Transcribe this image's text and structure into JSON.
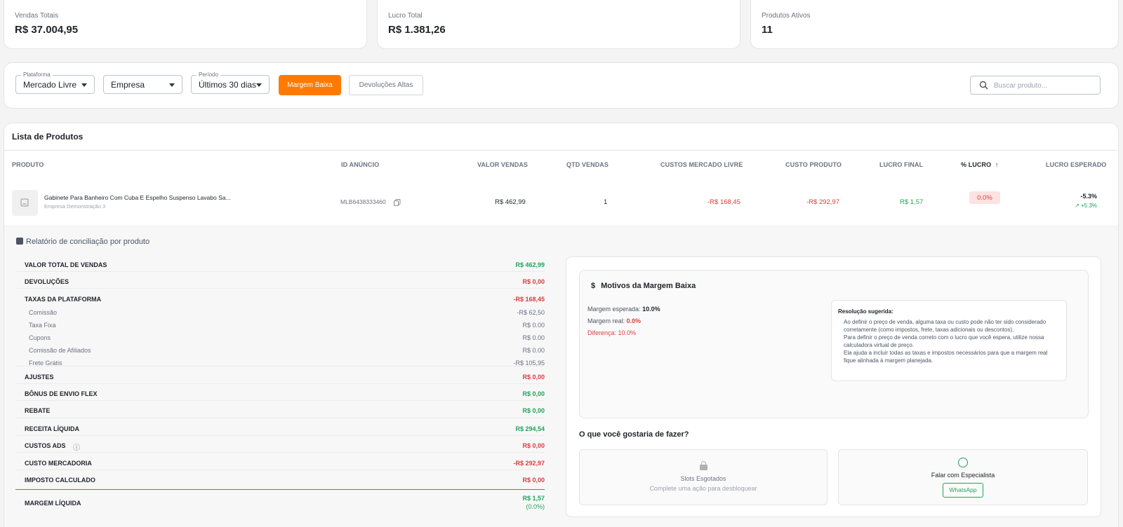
{
  "stats": [
    {
      "label": "Vendas Totais",
      "value": "R$ 37.004,95"
    },
    {
      "label": "Lucro Total",
      "value": "R$ 1.381,26"
    },
    {
      "label": "Produtos Ativos",
      "value": "11"
    }
  ],
  "filters": {
    "plataforma_legend": "Plataforma",
    "plataforma_value": "Mercado Livre",
    "empresa_value": "Empresa",
    "periodo_legend": "Período",
    "periodo_value": "Últimos 30 dias",
    "margem_baixa": "Margem Baixa",
    "devolucoes_altas": "Devoluções Altas",
    "search_placeholder": "Buscar produto..."
  },
  "list": {
    "title": "Lista de Produtos",
    "headers": [
      "PRODUTO",
      "ID ANÚNCIO",
      "VALOR VENDAS",
      "QTD VENDAS",
      "CUSTOS MERCADO LIVRE",
      "CUSTO PRODUTO",
      "LUCRO FINAL",
      "% LUCRO",
      "LUCRO ESPERADO"
    ],
    "sort_arrow": "↑",
    "row": {
      "name": "Gabinete Para Banheiro Com Cuba E Espelho Suspenso Lavabo Sa...",
      "company": "Empresa Demonstração 3",
      "id": "MLB6438333460",
      "valor": "R$ 462,99",
      "qtd": "1",
      "custos_ml": "-R$ 168,45",
      "custo_prod": "-R$ 292,97",
      "lucro_final": "R$ 1,57",
      "pct_lucro": "0.0%",
      "lucro_esperado": "-5.3%",
      "lucro_esperado_trend": "+5.3%"
    }
  },
  "report": {
    "title": "Relatório de conciliação por produto",
    "rows": [
      {
        "label": "VALOR TOTAL DE VENDAS",
        "value": "R$ 462,99",
        "type": "major",
        "color": "pos"
      },
      {
        "label": "DEVOLUÇÕES",
        "value": "R$ 0,00",
        "type": "major",
        "color": "neg"
      },
      {
        "label": "TAXAS DA PLATAFORMA",
        "value": "-R$ 168,45",
        "type": "major",
        "color": "neg"
      },
      {
        "label": "Comissão",
        "value": "-R$ 62,50",
        "type": "minor"
      },
      {
        "label": "Taxa Fixa",
        "value": "R$ 0.00",
        "type": "minor"
      },
      {
        "label": "Cupons",
        "value": "R$ 0.00",
        "type": "minor"
      },
      {
        "label": "Comissão de Afiliados",
        "value": "R$ 0.00",
        "type": "minor"
      },
      {
        "label": "Frete Grátis",
        "value": "-R$ 105,95",
        "type": "minor"
      },
      {
        "label": "AJUSTES",
        "value": "R$ 0,00",
        "type": "major",
        "color": "neg"
      },
      {
        "label": "BÔNUS DE ENVIO FLEX",
        "value": "R$ 0,00",
        "type": "major",
        "color": "pos"
      },
      {
        "label": "REBATE",
        "value": "R$ 0,00",
        "type": "major",
        "color": "pos"
      },
      {
        "label": "RECEITA LÍQUIDA",
        "value": "R$ 294,54",
        "type": "major",
        "color": "pos"
      },
      {
        "label": "CUSTOS ADS",
        "value": "R$ 0,00",
        "type": "major",
        "color": "neg"
      },
      {
        "label": "CUSTO MERCADORIA",
        "value": "-R$ 292,97",
        "type": "major",
        "color": "neg"
      },
      {
        "label": "IMPOSTO CALCULADO",
        "value": "R$ 0,00",
        "type": "major",
        "color": "neg"
      }
    ],
    "margem_label": "MARGEM LÍQUIDA",
    "margem_value": "R$ 1,57",
    "margem_pct": "(0.0%)"
  },
  "motivos": {
    "title": "Motivos da Margem Baixa",
    "esperada_label": "Margem esperada:",
    "esperada_value": "10.0%",
    "real_label": "Margem real:",
    "real_value": "0.0%",
    "diferenca": "Diferença: 10.0%",
    "res_title": "Resolução sugerida:",
    "res_p1": "Ao definir o preço de venda, alguma taxa ou custo pode não ter sido considerado corretamente (como impostos, frete, taxas adicionais ou descontos).",
    "res_p2": "Para definir o preço de venda correto com o lucro que você espera, utilize nossa calculadora virtual de preço.",
    "res_p3": "Ela ajuda a incluir todas as taxas e impostos necessários para que a margem real fique alinhada à margem planejada."
  },
  "actions": {
    "question": "O que você gostaria de fazer?",
    "slots_title": "Slots Esgotados",
    "slots_sub": "Complete uma ação para desbloquear",
    "especialista_title": "Falar com Especialista",
    "whatsapp": "WhatsApp"
  }
}
